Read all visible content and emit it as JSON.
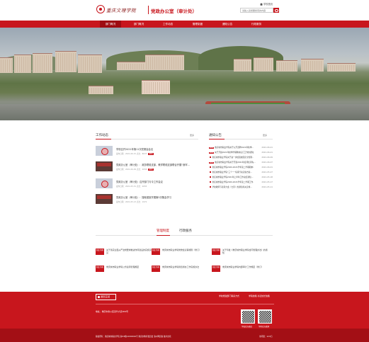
{
  "header": {
    "logo_text": "重庆文理学院",
    "office_title": "党政办公室（审计处）",
    "home_link": "学校首页",
    "search_placeholder": "请输入您想要搜索的内容"
  },
  "nav": [
    "部门概况",
    "部门概况",
    "工作动态",
    "管理制度",
    "通知公告",
    "行政服务"
  ],
  "work_news": {
    "title": "工作动态",
    "more": "更多",
    "items": [
      {
        "title": "学校召开2021年第11次党委会会议",
        "meta": "发布日期：2021-06-15  点击：8637",
        "tag": "NEW"
      },
      {
        "title": "党政办公室（审计处）：政务联络支部、教学联络支部联合开展“我牢…",
        "meta": "发布日期：2021-06-09  点击：4658",
        "tag": "NEW"
      },
      {
        "title": "党政办公室（审计处）召开部门与今工作会议",
        "meta": "发布日期：2021-05-31  点击：2655",
        "tag": ""
      },
      {
        "title": "党政办公室（审计处）：搜帐做室开展第5次集会学习",
        "meta": "发布日期：2021-05-13  点击：1972",
        "tag": ""
      }
    ]
  },
  "notices": {
    "title": "通知公告",
    "more": "更多",
    "items": [
      {
        "tag": "NEW",
        "text": "重庆城市职业学院关于公开选聘2021年秋季…",
        "date": "2021-06-21"
      },
      {
        "tag": "NEW",
        "text": "关于开展2021年秋季学期教材征订工作的通知",
        "date": "2021-06-21"
      },
      {
        "tag": "",
        "text": "重庆城市职业学院关于进一步加强校园安全管理…",
        "date": "2021-06-09"
      },
      {
        "tag": "NEW",
        "text": "重庆城市职业学院关于开展2021年度评优评先…",
        "date": "2021-06-07"
      },
      {
        "tag": "",
        "text": "重庆城市职业学院2020-2021学年第二学期期末考试…",
        "date": "2021-06-01"
      },
      {
        "tag": "",
        "text": "重庆城市职业学院“三个一”专项行动实施方案…",
        "date": "2021-05-27"
      },
      {
        "tag": "",
        "text": "重庆城市职业学院2021年上半年工作总结通知…",
        "date": "2021-05-18"
      },
      {
        "tag": "",
        "text": "重庆城市职业学院2020-2021学年第二学期工作…",
        "date": "2021-05-17"
      },
      {
        "tag": "",
        "text": "学校教师节表彰大会（七月）的通知有关安排…",
        "date": "2021-05-11"
      }
    ]
  },
  "tabs": [
    "管理制度",
    "行政服务"
  ],
  "rules": [
    {
      "badge": "制度\n条例",
      "text": "关于落实全面从严治党要求推进作风建设的实施意见"
    },
    {
      "badge": "制度\n条例",
      "text": "重庆城市职业学院党委会议事规则（修订）"
    },
    {
      "badge": "制度\n条例",
      "text": "关于印发《重庆城市职业学院合同管理办法》的通知"
    },
    {
      "badge": "制度\n条例",
      "text": "重庆城市职业学院公务接待管理规定"
    },
    {
      "badge": "制度\n条例",
      "text": "重庆城市职业学院督查督办工作实施办法"
    },
    {
      "badge": "制度\n条例",
      "text": "重庆城市职业学院内部审计工作规定（修订）"
    }
  ],
  "footer": {
    "back_label": "返回主站",
    "links": [
      "学校党政部门联系方式",
      "学院信箱 书记校长信箱"
    ],
    "address": "地址：重庆市永川区双竹大道309号",
    "qr_labels": [
      "学校官方微信",
      "学院官方微博"
    ],
    "copyright": "版权所有：重庆城市职业学院 渝ICP备12002016号 重庆市教育委员会 渝公网安备 技术支持：",
    "visits": "访问量：12.8万"
  }
}
